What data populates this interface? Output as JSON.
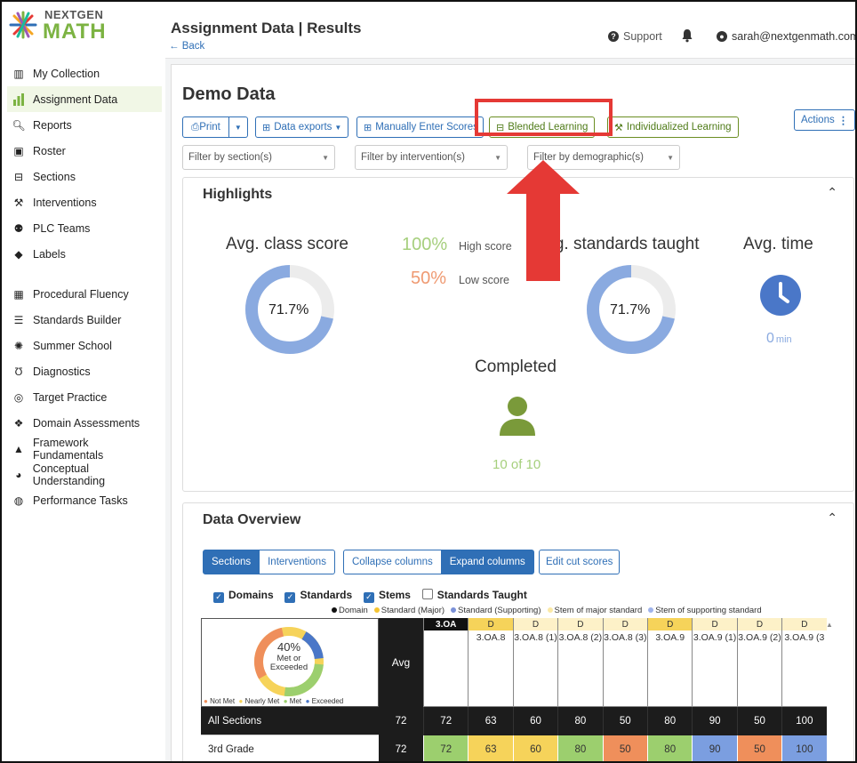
{
  "brand": {
    "top": "NEXTGEN",
    "bottom": "MATH"
  },
  "header": {
    "title": "Assignment Data | Results",
    "back": "← Back",
    "support": "Support",
    "user": "sarah@nextgenmath.com"
  },
  "sidebar": {
    "items": [
      {
        "label": "My Collection",
        "icon": "books-icon"
      },
      {
        "label": "Assignment Data",
        "icon": "bar-chart-icon"
      },
      {
        "label": "Reports",
        "icon": "magnify-icon"
      },
      {
        "label": "Roster",
        "icon": "id-card-icon"
      },
      {
        "label": "Sections",
        "icon": "sections-icon"
      },
      {
        "label": "Interventions",
        "icon": "intervention-icon"
      },
      {
        "label": "PLC Teams",
        "icon": "team-icon"
      },
      {
        "label": "Labels",
        "icon": "tag-icon"
      }
    ],
    "items2": [
      {
        "label": "Procedural Fluency",
        "icon": "grid-icon"
      },
      {
        "label": "Standards Builder",
        "icon": "list-icon"
      },
      {
        "label": "Summer School",
        "icon": "sun-icon"
      },
      {
        "label": "Diagnostics",
        "icon": "stethoscope-icon"
      },
      {
        "label": "Target Practice",
        "icon": "target-icon"
      },
      {
        "label": "Domain Assessments",
        "icon": "cubes-icon"
      },
      {
        "label": "Framework Fundamentals",
        "icon": "pyramid-icon"
      },
      {
        "label": "Conceptual Understanding",
        "icon": "brain-icon"
      },
      {
        "label": "Performance Tasks",
        "icon": "globe-icon"
      }
    ]
  },
  "main": {
    "title": "Demo Data",
    "toolbar": {
      "print": "Print",
      "data_exports": "Data exports",
      "manually_enter": "Manually Enter Scores",
      "blended": "Blended Learning",
      "individualized": "Individualized Learning",
      "actions": "Actions"
    },
    "filters": {
      "section": "Filter by section(s)",
      "intervention": "Filter by intervention(s)",
      "demographic": "Filter by demographic(s)"
    }
  },
  "highlights": {
    "title": "Highlights",
    "avg_class_score": {
      "label": "Avg. class score",
      "value": "71.7%",
      "fraction": 0.717
    },
    "high": {
      "pct": "100%",
      "label": "High score"
    },
    "low": {
      "pct": "50%",
      "label": "Low score"
    },
    "avg_standards": {
      "label": "Avg. standards taught",
      "value": "71.7%",
      "fraction": 0.717
    },
    "avg_time": {
      "label": "Avg. time",
      "value": "0",
      "unit": "min"
    },
    "completed": {
      "label": "Completed",
      "value": "10 of 10"
    }
  },
  "overview": {
    "title": "Data Overview",
    "group_tabs": [
      "Sections",
      "Interventions"
    ],
    "column_tabs": [
      "Collapse columns",
      "Expand columns"
    ],
    "edit_cut": "Edit cut scores",
    "checkboxes": [
      {
        "label": "Domains",
        "checked": true
      },
      {
        "label": "Standards",
        "checked": true
      },
      {
        "label": "Stems",
        "checked": true
      },
      {
        "label": "Standards Taught",
        "checked": false
      }
    ],
    "key": [
      {
        "label": "Domain",
        "color": "#111111"
      },
      {
        "label": "Standard (Major)",
        "color": "#f5c431"
      },
      {
        "label": "Standard (Supporting)",
        "color": "#7b91d8"
      },
      {
        "label": "Stem of major standard",
        "color": "#fbe9a6"
      },
      {
        "label": "Stem of supporting standard",
        "color": "#9fb3ea"
      }
    ],
    "donut": {
      "pct": "40%",
      "line1": "Met or",
      "line2": "Exceeded",
      "legend": [
        "Not Met",
        "Nearly Met",
        "Met",
        "Exceeded"
      ]
    },
    "avg_header": "Avg",
    "columns": [
      {
        "code": "3.OA",
        "tag": "",
        "label": "",
        "head": "#111111"
      },
      {
        "code": "",
        "tag": "D",
        "label": "3.OA.8",
        "head": "#f6d35a"
      },
      {
        "code": "",
        "tag": "D",
        "label": "3.OA.8 (1)",
        "head": "#fdf1c8"
      },
      {
        "code": "",
        "tag": "D",
        "label": "3.OA.8 (2)",
        "head": "#fdf1c8"
      },
      {
        "code": "",
        "tag": "D",
        "label": "3.OA.8 (3)",
        "head": "#fdf1c8"
      },
      {
        "code": "",
        "tag": "D",
        "label": "3.OA.9",
        "head": "#f6d35a"
      },
      {
        "code": "",
        "tag": "D",
        "label": "3.OA.9 (1)",
        "head": "#fdf1c8"
      },
      {
        "code": "",
        "tag": "D",
        "label": "3.OA.9 (2)",
        "head": "#fdf1c8"
      },
      {
        "code": "",
        "tag": "D",
        "label": "3.OA.9 (3",
        "head": "#fdf1c8"
      }
    ],
    "rows": [
      {
        "label": "All Sections",
        "avg": "72",
        "values": [
          "72",
          "63",
          "60",
          "80",
          "50",
          "80",
          "90",
          "50",
          "100"
        ],
        "dark": true
      },
      {
        "label": "3rd Grade",
        "avg": "72",
        "values": [
          "72",
          "63",
          "60",
          "80",
          "50",
          "80",
          "90",
          "50",
          "100"
        ],
        "dark": false,
        "colors": [
          "#9ccf6e",
          "#f6d35a",
          "#f6d35a",
          "#9ccf6e",
          "#ef8f5b",
          "#9ccf6e",
          "#7b9ee0",
          "#ef8f5b",
          "#7b9ee0"
        ]
      }
    ]
  },
  "colors": {
    "accent": "#2f6fb6",
    "green": "#7cb342",
    "red": "#e53935",
    "donut": "#8aaae0"
  }
}
